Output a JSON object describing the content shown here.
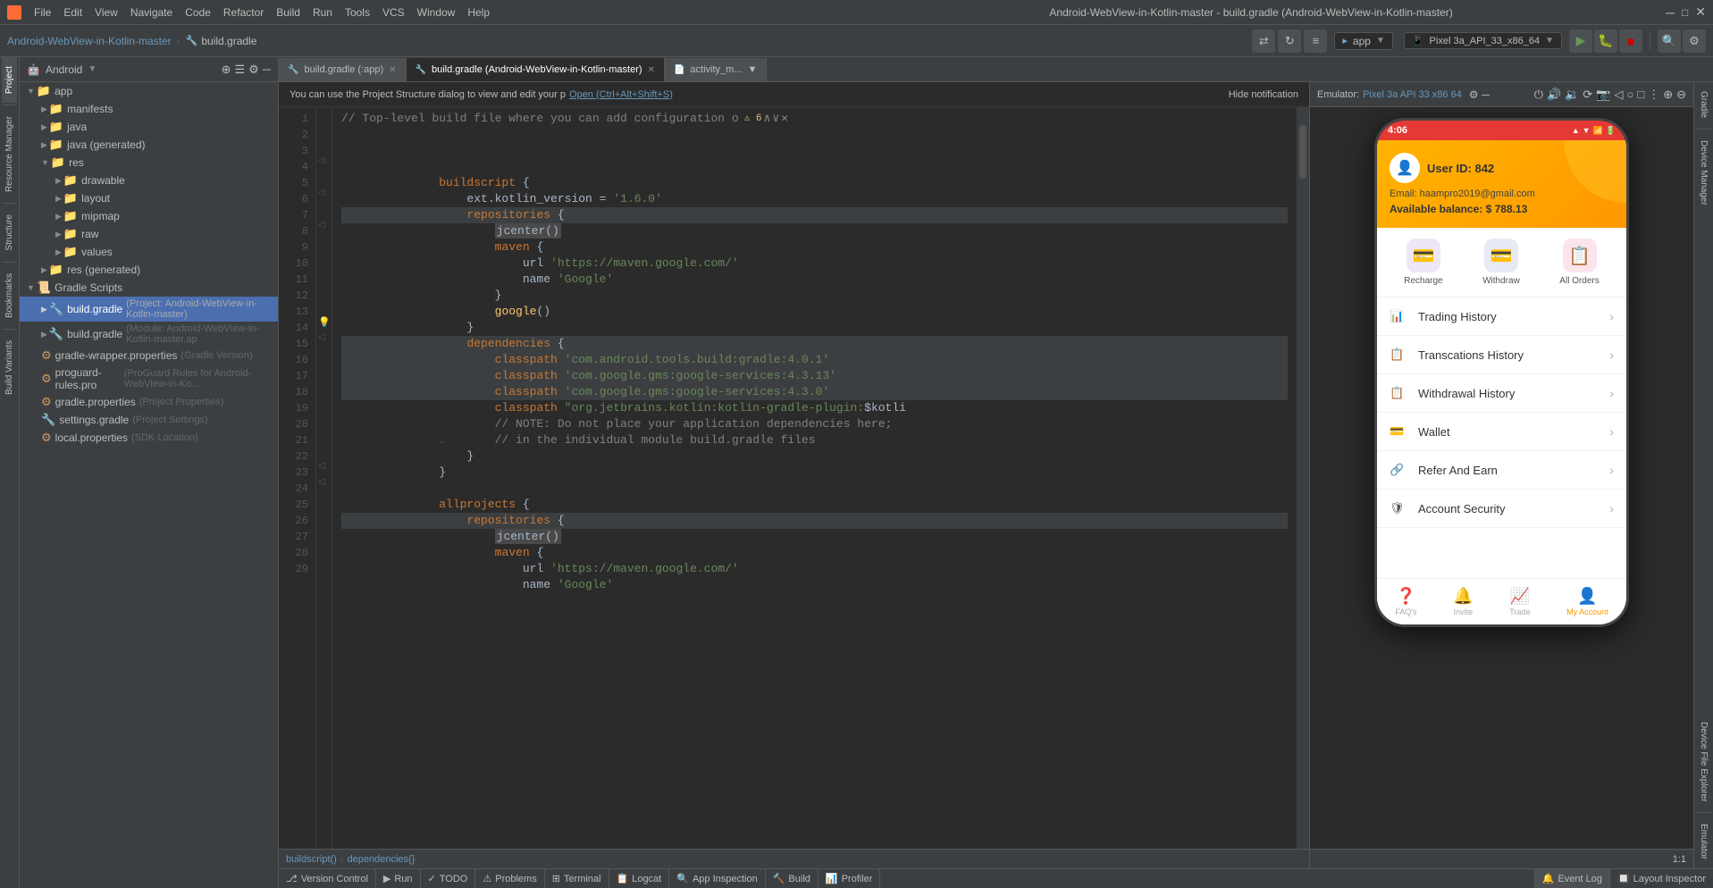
{
  "app": {
    "title": "Android-WebView-in-Kotlin-master - build.gradle (Android-WebView-in-Kotlin-master)",
    "project_name": "Android-WebView-in-Kotlin-master",
    "file_name": "build.gradle"
  },
  "menu_items": [
    "File",
    "Edit",
    "View",
    "Navigate",
    "Code",
    "Refactor",
    "Build",
    "Run",
    "Tools",
    "VCS",
    "Window",
    "Help"
  ],
  "toolbar": {
    "run_config": "app",
    "device": "Pixel 3a_API_33_x86_64"
  },
  "project_panel": {
    "title": "Android",
    "tree": [
      {
        "label": "app",
        "type": "folder",
        "indent": 0,
        "expanded": true
      },
      {
        "label": "manifests",
        "type": "folder",
        "indent": 1,
        "expanded": false
      },
      {
        "label": "java",
        "type": "folder",
        "indent": 1,
        "expanded": false
      },
      {
        "label": "java (generated)",
        "type": "folder",
        "indent": 1,
        "expanded": false
      },
      {
        "label": "res",
        "type": "folder",
        "indent": 1,
        "expanded": true
      },
      {
        "label": "drawable",
        "type": "folder",
        "indent": 2,
        "expanded": false
      },
      {
        "label": "layout",
        "type": "folder",
        "indent": 2,
        "expanded": false
      },
      {
        "label": "mipmap",
        "type": "folder",
        "indent": 2,
        "expanded": false
      },
      {
        "label": "raw",
        "type": "folder",
        "indent": 2,
        "expanded": false
      },
      {
        "label": "values",
        "type": "folder",
        "indent": 2,
        "expanded": false
      },
      {
        "label": "res (generated)",
        "type": "folder",
        "indent": 1,
        "expanded": false
      },
      {
        "label": "Gradle Scripts",
        "type": "folder",
        "indent": 0,
        "expanded": true
      },
      {
        "label": "build.gradle",
        "sublabel": "(Project: Android-WebView-in-Kotlin-master)",
        "type": "gradle",
        "indent": 1,
        "expanded": false,
        "selected": true
      },
      {
        "label": "build.gradle",
        "sublabel": "(Module: Android-WebView-in-Kotlin-master.ap",
        "type": "gradle",
        "indent": 1,
        "expanded": false
      },
      {
        "label": "gradle-wrapper.properties",
        "sublabel": "(Gradle Version)",
        "type": "props",
        "indent": 1
      },
      {
        "label": "proguard-rules.pro",
        "sublabel": "(ProGuard Rules for Android-WebView-in-Ko...",
        "type": "props",
        "indent": 1
      },
      {
        "label": "gradle.properties",
        "sublabel": "(Project Properties)",
        "type": "props",
        "indent": 1
      },
      {
        "label": "settings.gradle",
        "sublabel": "(Project Settings)",
        "type": "gradle",
        "indent": 1
      },
      {
        "label": "local.properties",
        "sublabel": "(SDK Location)",
        "type": "props",
        "indent": 1
      }
    ]
  },
  "editor_tabs": [
    {
      "label": "build.gradle (:app)",
      "type": "gradle",
      "active": false
    },
    {
      "label": "build.gradle (Android-WebView-in-Kotlin-master)",
      "type": "gradle",
      "active": true
    },
    {
      "label": "activity_m...",
      "type": "xml",
      "active": false
    }
  ],
  "notification": {
    "text": "You can use the Project Structure dialog to view and edit your p",
    "link_text": "Open (Ctrl+Alt+Shift+S)",
    "hide_text": "Hide notification"
  },
  "code_lines": [
    {
      "num": 1,
      "text": "// Top-level build file where you can add configuration o",
      "type": "comment",
      "warn": true
    },
    {
      "num": 2,
      "text": ""
    },
    {
      "num": 3,
      "text": ""
    },
    {
      "num": 4,
      "text": "buildscript {"
    },
    {
      "num": 5,
      "text": "    ext.kotlin_version = '1.6.0'"
    },
    {
      "num": 6,
      "text": "    repositories {"
    },
    {
      "num": 7,
      "text": "        jcenter()",
      "highlight": true
    },
    {
      "num": 8,
      "text": "        maven {"
    },
    {
      "num": 9,
      "text": "            url 'https://maven.google.com/'"
    },
    {
      "num": 10,
      "text": "            name 'Google'"
    },
    {
      "num": 11,
      "text": "        }"
    },
    {
      "num": 12,
      "text": "        google()"
    },
    {
      "num": 13,
      "text": "    }"
    },
    {
      "num": 14,
      "text": "    dependencies {",
      "marker": true
    },
    {
      "num": 15,
      "text": "        classpath 'com.android.tools.build:gradle:4.0.1'",
      "highlight": true
    },
    {
      "num": 16,
      "text": "        classpath 'com.google.gms:google-services:4.3.13'",
      "highlight": true
    },
    {
      "num": 17,
      "text": "        classpath 'com.google.gms:google-services:4.3.0'",
      "highlight": true
    },
    {
      "num": 18,
      "text": "        classpath \"org.jetbrains.kotlin:kotlin-gradle-plugin:$kotli",
      "highlight": true
    },
    {
      "num": 19,
      "text": "        // NOTE: Do not place your application dependencies here;"
    },
    {
      "num": 20,
      "text": "        // in the individual module build.gradle files"
    },
    {
      "num": 21,
      "text": "    }"
    },
    {
      "num": 22,
      "text": "}"
    },
    {
      "num": 23,
      "text": ""
    },
    {
      "num": 24,
      "text": "allprojects {"
    },
    {
      "num": 25,
      "text": "    repositories {"
    },
    {
      "num": 26,
      "text": "        jcenter()",
      "highlight": true
    },
    {
      "num": 27,
      "text": "        maven {"
    },
    {
      "num": 28,
      "text": "            url 'https://maven.google.com/'"
    },
    {
      "num": 29,
      "text": "            name 'Google'"
    }
  ],
  "emulator": {
    "title": "Emulator:",
    "device": "Pixel 3a API 33 x86 64"
  },
  "phone": {
    "time": "4:06",
    "user_id": "User ID: 842",
    "email": "Email: haampro2019@gmail.com",
    "balance": "Available balance: $ 788.13",
    "actions": [
      {
        "label": "Recharge",
        "icon": "💳"
      },
      {
        "label": "Withdraw",
        "icon": "💳"
      },
      {
        "label": "All Orders",
        "icon": "📋"
      }
    ],
    "menu_items": [
      {
        "label": "Trading History",
        "icon": "📊"
      },
      {
        "label": "Transcations History",
        "icon": "📋"
      },
      {
        "label": "Withdrawal History",
        "icon": "📋"
      },
      {
        "label": "Wallet",
        "icon": "💳"
      },
      {
        "label": "Refer And Earn",
        "icon": "🔗"
      },
      {
        "label": "Account Security",
        "icon": "🛡"
      }
    ],
    "bottom_nav": [
      {
        "label": "FAQ's",
        "icon": "❓",
        "active": false
      },
      {
        "label": "Invite",
        "icon": "🔔",
        "active": false
      },
      {
        "label": "Trade",
        "icon": "📈",
        "active": false
      },
      {
        "label": "My Account",
        "icon": "👤",
        "active": true
      }
    ]
  },
  "bottom_tabs": [
    {
      "label": "Version Control",
      "icon": "⎇"
    },
    {
      "label": "Run",
      "icon": "▶"
    },
    {
      "label": "TODO",
      "icon": "✓"
    },
    {
      "label": "Problems",
      "icon": "⚠"
    },
    {
      "label": "Terminal",
      "icon": "⊞"
    },
    {
      "label": "Logcat",
      "icon": "📋"
    },
    {
      "label": "App Inspection",
      "icon": "🔍"
    },
    {
      "label": "Build",
      "icon": "🔨"
    },
    {
      "label": "Profiler",
      "icon": "📊"
    }
  ],
  "breadcrumb": {
    "items": [
      "buildscript()",
      "dependencies{}"
    ]
  },
  "status_bar": {
    "event_log": "Event Log",
    "layout_inspector": "Layout Inspector"
  },
  "left_tabs": [
    "Project",
    "Resource Manager",
    "Structure",
    "Bookmarks",
    "Build Variants"
  ],
  "right_tabs": [
    "Gradle",
    "Device Manager"
  ],
  "emu_side_tabs": [
    "Device File Explorer",
    "Emulator"
  ]
}
